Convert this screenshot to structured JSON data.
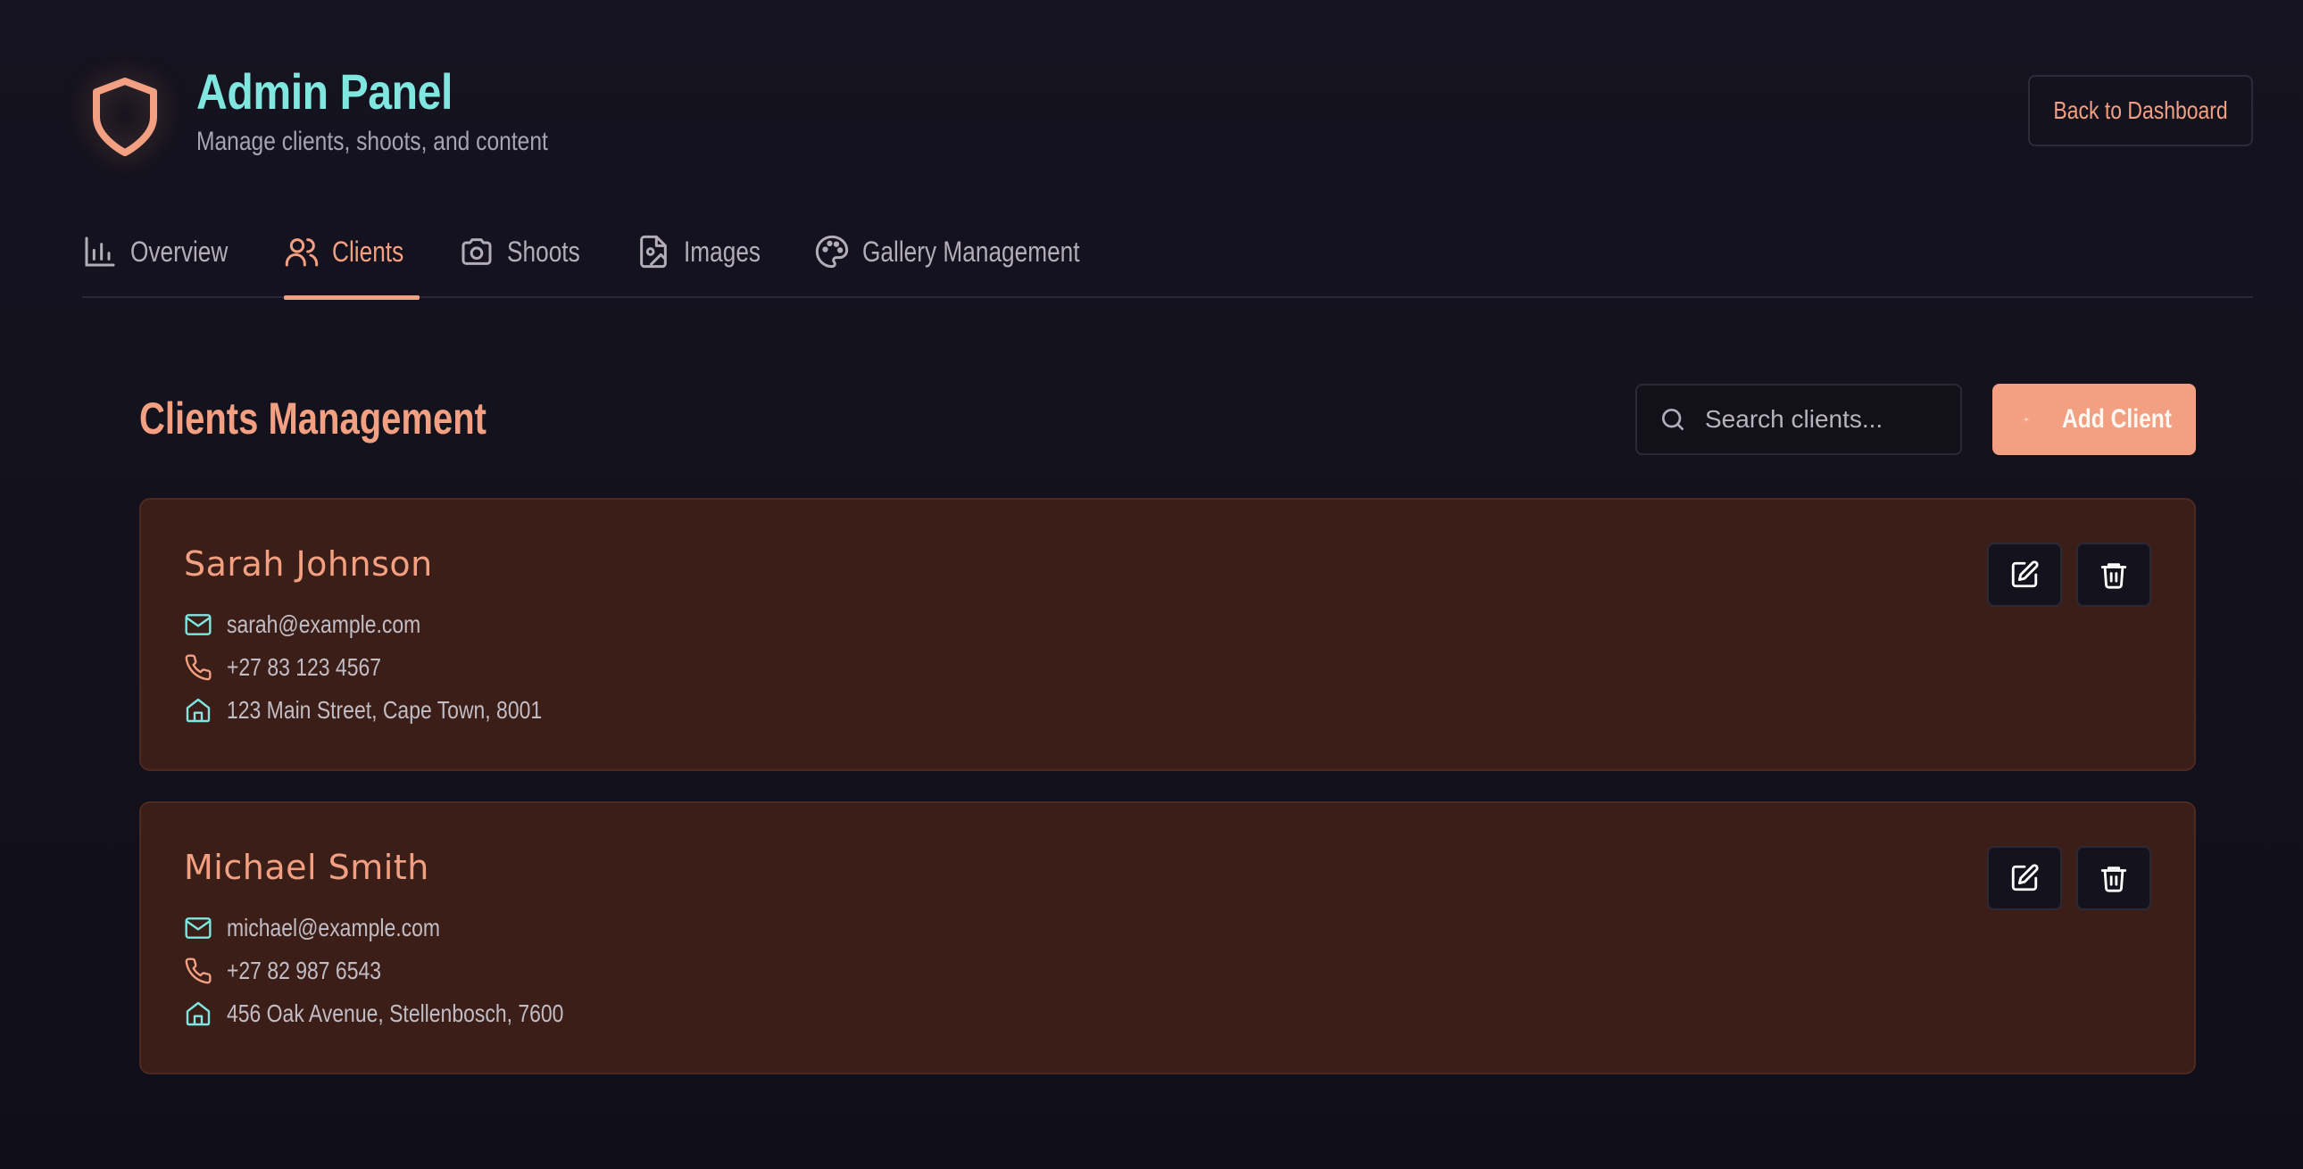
{
  "header": {
    "title": "Admin Panel",
    "subtitle": "Manage clients, shoots, and content",
    "back_label": "Back to Dashboard",
    "icon": "shield-icon"
  },
  "tabs": [
    {
      "label": "Overview",
      "icon": "bar-chart-icon",
      "active": false
    },
    {
      "label": "Clients",
      "icon": "users-icon",
      "active": true
    },
    {
      "label": "Shoots",
      "icon": "camera-icon",
      "active": false
    },
    {
      "label": "Images",
      "icon": "file-image-icon",
      "active": false
    },
    {
      "label": "Gallery Management",
      "icon": "palette-icon",
      "active": false
    }
  ],
  "section": {
    "title": "Clients Management",
    "search_placeholder": "Search clients...",
    "search_value": "",
    "add_label": "Add Client"
  },
  "clients": [
    {
      "name": "Sarah Johnson",
      "email": "sarah@example.com",
      "phone": "+27 83 123 4567",
      "address": "123 Main Street, Cape Town, 8001"
    },
    {
      "name": "Michael Smith",
      "email": "michael@example.com",
      "phone": "+27 82 987 6543",
      "address": "456 Oak Avenue, Stellenbosch, 7600"
    }
  ],
  "colors": {
    "accent": "#f2a081",
    "teal": "#7fe7df",
    "background": "#13111c",
    "card": "#3a1e17"
  }
}
